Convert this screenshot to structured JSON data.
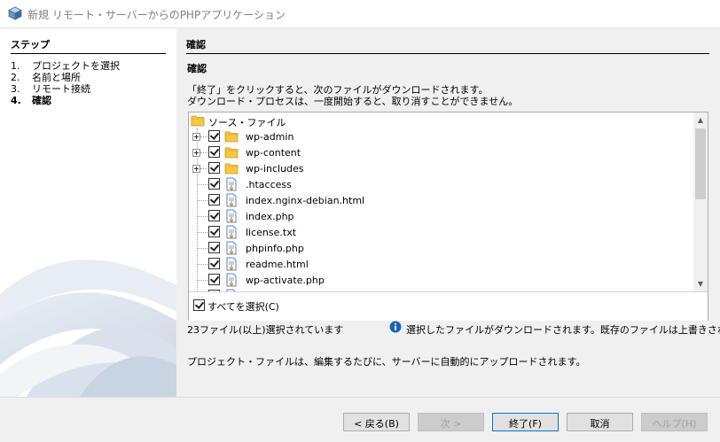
{
  "window": {
    "title": "新規 リモート・サーバーからのPHPアプリケーション"
  },
  "steps": {
    "title": "ステップ",
    "items": [
      {
        "num": "1.",
        "label": "プロジェクトを選択"
      },
      {
        "num": "2.",
        "label": "名前と場所"
      },
      {
        "num": "3.",
        "label": "リモート接続"
      },
      {
        "num": "4.",
        "label": "確認"
      }
    ]
  },
  "panel": {
    "heading": "確認",
    "subheading": "確認",
    "description_line1": "「終了」をクリックすると、次のファイルがダウンロードされます。",
    "description_line2": "ダウンロード・プロセスは、一度開始すると、取り消すことができません。"
  },
  "tree": {
    "root": "ソース・ファイル",
    "items": [
      {
        "label": "wp-admin",
        "type": "folder",
        "expandable": true
      },
      {
        "label": "wp-content",
        "type": "folder",
        "expandable": true
      },
      {
        "label": "wp-includes",
        "type": "folder",
        "expandable": true
      },
      {
        "label": ".htaccess",
        "type": "file"
      },
      {
        "label": "index.nginx-debian.html",
        "type": "file"
      },
      {
        "label": "index.php",
        "type": "file"
      },
      {
        "label": "license.txt",
        "type": "file"
      },
      {
        "label": "phpinfo.php",
        "type": "file"
      },
      {
        "label": "readme.html",
        "type": "file"
      },
      {
        "label": "wp-activate.php",
        "type": "file"
      },
      {
        "label": "",
        "type": "file"
      }
    ]
  },
  "select_all": {
    "label": "すべてを選択(C)",
    "checked": true
  },
  "status": {
    "count": "23ファイル(以上)選択されています",
    "info": "選択したファイルがダウンロードされます。既存のファイルは上書きされます。",
    "upload_note": "プロジェクト・ファイルは、編集するたびに、サーバーに自動的にアップロードされます。"
  },
  "buttons": {
    "back": "< 戻る(B)",
    "next": "次 >",
    "finish": "終了(F)",
    "cancel": "取消",
    "help": "ヘルプ(H)"
  },
  "colors": {
    "folder": "#f5c842",
    "file_doc": "#5b7fc9",
    "accent": "#0078d7",
    "info": "#1e64b4"
  }
}
